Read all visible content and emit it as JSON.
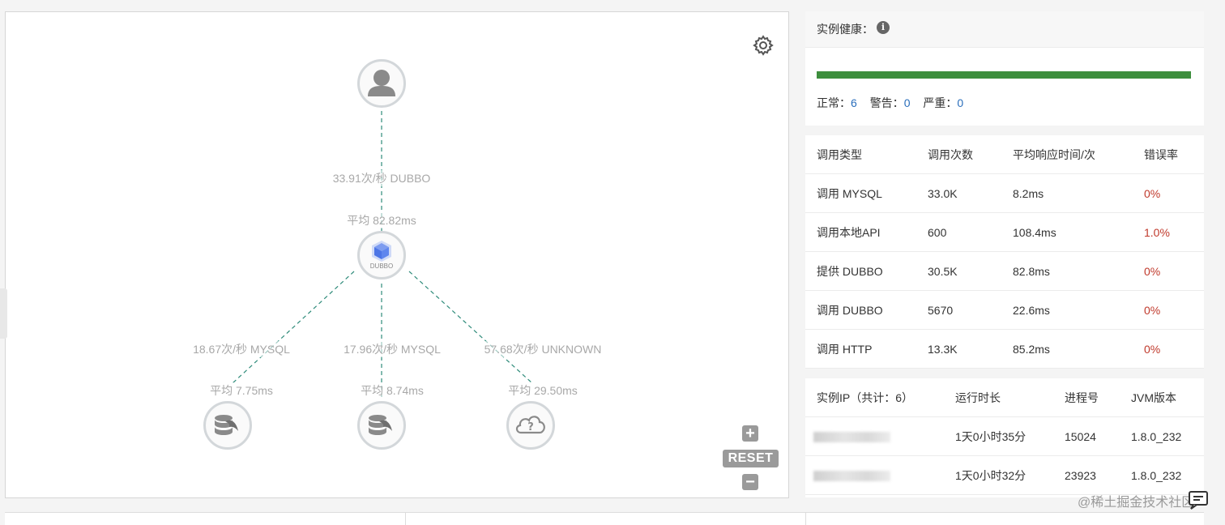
{
  "topology": {
    "nodes": [
      {
        "id": "user",
        "icon": "user-icon"
      },
      {
        "id": "service",
        "icon": "cube-icon",
        "tag": "DUBBO"
      },
      {
        "id": "mysql-1",
        "icon": "mysql-database-icon"
      },
      {
        "id": "mysql-2",
        "icon": "mysql-database-icon"
      },
      {
        "id": "unknown",
        "icon": "cloud-question-icon"
      }
    ],
    "edges": [
      {
        "rate": "33.91次/秒 DUBBO",
        "avg": "平均 82.82ms"
      },
      {
        "rate": "18.67次/秒 MYSQL",
        "avg": "平均 7.75ms"
      },
      {
        "rate": "17.96次/秒 MYSQL",
        "avg": "平均 8.74ms"
      },
      {
        "rate": "57.68次/秒 UNKNOWN",
        "avg": "平均 29.50ms"
      }
    ],
    "controls": {
      "zoom_in": "+",
      "reset": "RESET",
      "zoom_out": "−"
    },
    "edge_color": "#2e8b7a"
  },
  "health": {
    "title": "实例健康：",
    "bar_color": "#3d8e3d",
    "normal_label": "正常：",
    "normal_value": "6",
    "warning_label": "警告：",
    "warning_value": "0",
    "severe_label": "严重：",
    "severe_value": "0"
  },
  "calls_table": {
    "headers": [
      "调用类型",
      "调用次数",
      "平均响应时间/次",
      "错误率"
    ],
    "rows": [
      [
        "调用 MYSQL",
        "33.0K",
        "8.2ms",
        "0%"
      ],
      [
        "调用本地API",
        "600",
        "108.4ms",
        "1.0%"
      ],
      [
        "提供 DUBBO",
        "30.5K",
        "82.8ms",
        "0%"
      ],
      [
        "调用 DUBBO",
        "5670",
        "22.6ms",
        "0%"
      ],
      [
        "调用 HTTP",
        "13.3K",
        "85.2ms",
        "0%"
      ]
    ],
    "error_color": "#c0392b"
  },
  "instances_table": {
    "headers": [
      "实例IP（共计：6）",
      "运行时长",
      "进程号",
      "JVM版本"
    ],
    "rows": [
      [
        "",
        "1天0小时35分",
        "15024",
        "1.8.0_232"
      ],
      [
        "",
        "1天0小时32分",
        "23923",
        "1.8.0_232"
      ]
    ]
  },
  "watermark": "@稀土掘金技术社区"
}
